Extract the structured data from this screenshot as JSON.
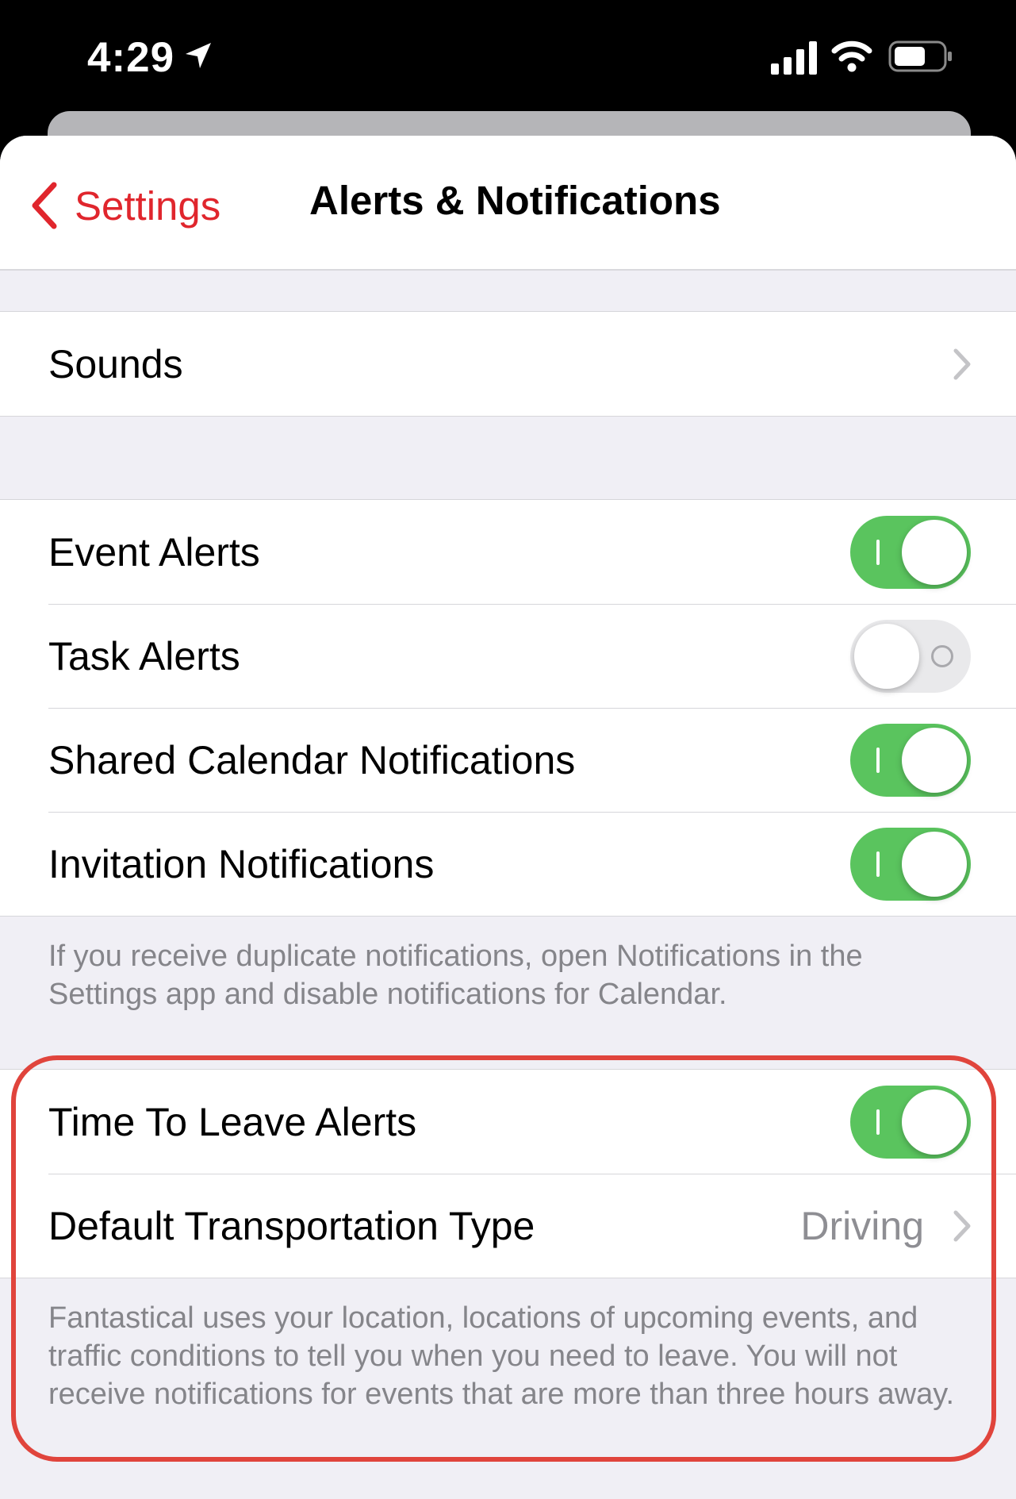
{
  "status_bar": {
    "time": "4:29",
    "location_icon": "location-arrow-icon",
    "signal_icon": "cellular-signal-icon",
    "wifi_icon": "wifi-icon",
    "battery_icon": "battery-icon"
  },
  "nav": {
    "back_label": "Settings",
    "title": "Alerts & Notifications"
  },
  "sounds_group": {
    "sounds_label": "Sounds"
  },
  "alerts_group": {
    "event_alerts": {
      "label": "Event Alerts",
      "enabled": true
    },
    "task_alerts": {
      "label": "Task Alerts",
      "enabled": false
    },
    "shared_calendar": {
      "label": "Shared Calendar Notifications",
      "enabled": true
    },
    "invitation": {
      "label": "Invitation Notifications",
      "enabled": true
    },
    "footnote": "If you receive duplicate notifications, open Notifications in the Settings app and disable notifications for Calendar."
  },
  "leave_group": {
    "time_to_leave": {
      "label": "Time To Leave Alerts",
      "enabled": true
    },
    "transport": {
      "label": "Default Transportation Type",
      "value": "Driving"
    },
    "footnote": "Fantastical uses your location, locations of upcoming events, and traffic conditions to tell you when you need to leave. You will not receive notifications for events that are more than three hours away."
  },
  "colors": {
    "accent": "#e0262d",
    "toggle_on": "#5ac45e",
    "toggle_off": "#e9e9eb",
    "highlight_border": "#e0443c",
    "grouped_background": "#f0eff5"
  }
}
